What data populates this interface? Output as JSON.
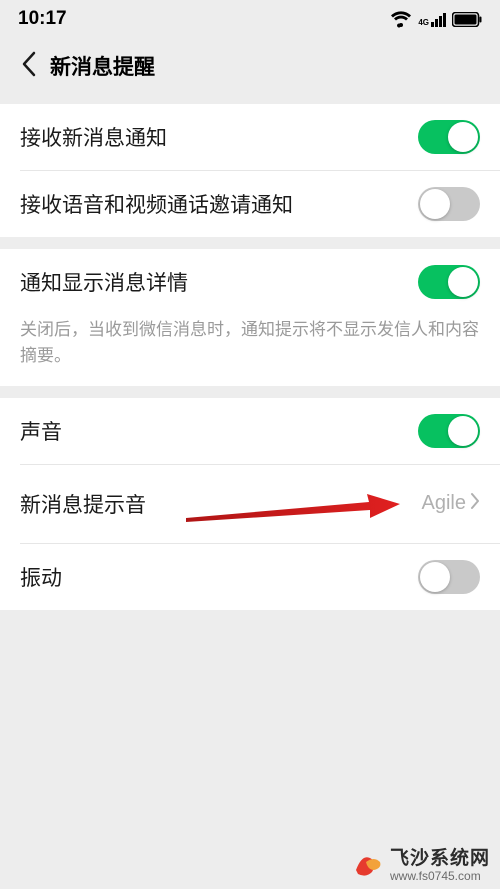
{
  "status": {
    "time": "10:17",
    "signal_label": "4G"
  },
  "nav": {
    "title": "新消息提醒"
  },
  "rows": {
    "receive_msg": {
      "label": "接收新消息通知",
      "on": true
    },
    "receive_call": {
      "label": "接收语音和视频通话邀请通知",
      "on": false
    },
    "show_detail": {
      "label": "通知显示消息详情",
      "on": true
    },
    "show_detail_hint": "关闭后，当收到微信消息时，通知提示将不显示发信人和内容摘要。",
    "sound": {
      "label": "声音",
      "on": true
    },
    "tone": {
      "label": "新消息提示音",
      "value": "Agile"
    },
    "vibrate": {
      "label": "振动",
      "on": false
    }
  },
  "watermark": {
    "title": "飞沙系统网",
    "sub": "www.fs0745.com"
  }
}
